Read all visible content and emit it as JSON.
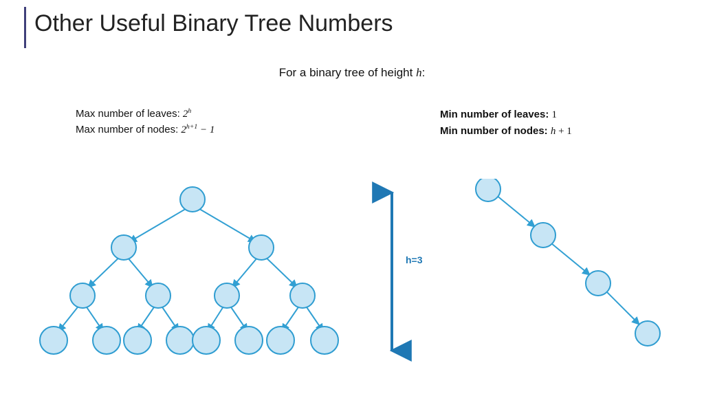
{
  "title": "Other Useful Binary Tree Numbers",
  "subtitle_prefix": "For a binary tree of height ",
  "subtitle_var": "h",
  "subtitle_suffix": ":",
  "left": {
    "leaves_label": "Max number of leaves: ",
    "leaves_base": "2",
    "leaves_exp": "h",
    "nodes_label": "Max number of nodes: ",
    "nodes_base": "2",
    "nodes_exp": "h+1",
    "nodes_tail": " − 1"
  },
  "right": {
    "leaves_label": "Min number of leaves: ",
    "leaves_value": "1",
    "nodes_label": "Min number of nodes: ",
    "nodes_expr_var": "h",
    "nodes_expr_tail": " + 1"
  },
  "h_label": "h=3",
  "colors": {
    "node_fill": "#c7e5f5",
    "node_stroke": "#2f9dd1",
    "edge": "#32a0d3",
    "arrow_bar": "#1f78b4"
  },
  "chart_data": {
    "type": "diagram",
    "description": "Two binary trees of height 3",
    "height_value": 3,
    "full_tree": {
      "levels": 4,
      "node_counts_per_level": [
        1,
        2,
        4,
        8
      ],
      "total_nodes": 15,
      "leaves": 8
    },
    "skewed_tree": {
      "levels": 4,
      "node_counts_per_level": [
        1,
        1,
        1,
        1
      ],
      "total_nodes": 4,
      "leaves": 1,
      "direction": "right"
    }
  }
}
